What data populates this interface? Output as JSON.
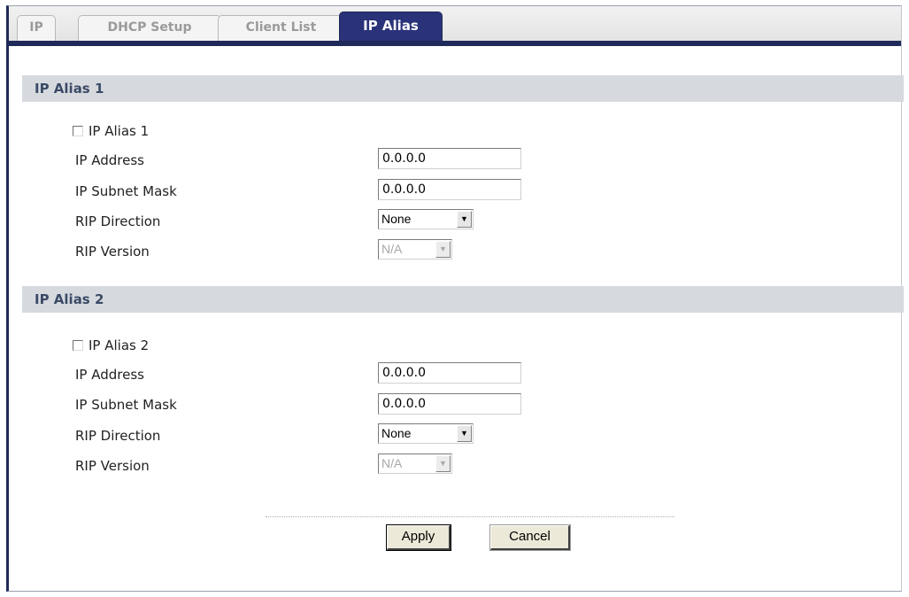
{
  "tabs": [
    {
      "label": "IP",
      "active": false
    },
    {
      "label": "DHCP Setup",
      "active": false
    },
    {
      "label": "Client List",
      "active": false
    },
    {
      "label": "IP Alias",
      "active": true
    }
  ],
  "alias1": {
    "header": "IP Alias 1",
    "checkbox_label": "IP Alias 1",
    "checked": false,
    "ip_address_label": "IP Address",
    "ip_address_value": "0.0.0.0",
    "subnet_label": "IP Subnet Mask",
    "subnet_value": "0.0.0.0",
    "rip_direction_label": "RIP Direction",
    "rip_direction_value": "None",
    "rip_version_label": "RIP Version",
    "rip_version_value": "N/A"
  },
  "alias2": {
    "header": "IP Alias 2",
    "checkbox_label": "IP Alias 2",
    "checked": false,
    "ip_address_label": "IP Address",
    "ip_address_value": "0.0.0.0",
    "subnet_label": "IP Subnet Mask",
    "subnet_value": "0.0.0.0",
    "rip_direction_label": "RIP Direction",
    "rip_direction_value": "None",
    "rip_version_label": "RIP Version",
    "rip_version_value": "N/A"
  },
  "actions": {
    "apply_label": "Apply",
    "cancel_label": "Cancel"
  },
  "colors": {
    "active_tab": "#2a3279",
    "section_header_bg": "#d6dadf",
    "section_header_text": "#3b4a66"
  }
}
